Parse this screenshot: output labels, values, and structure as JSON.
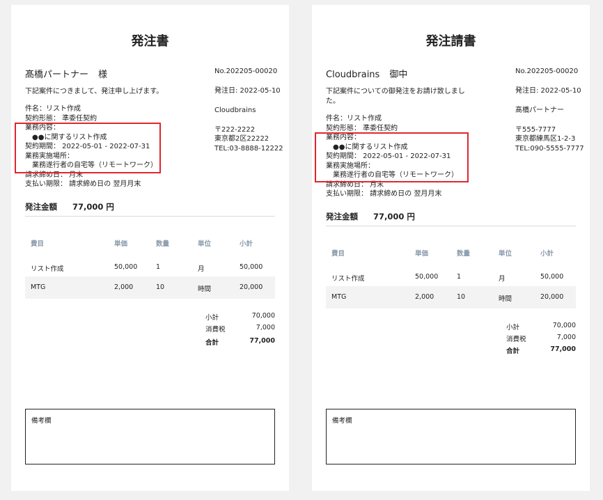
{
  "left_doc": {
    "title": "発注書",
    "addressee": "髙橋パートナー",
    "honorific": "様",
    "intro": "下記案件につきまして、発注申し上げます。",
    "lines": [
      "件名：リスト作成",
      "契約形態： 準委任契約",
      "業務内容：",
      "●●に関するリスト作成",
      "契約期間： 2022-05-01 - 2022-07-31",
      "業務実施場所：",
      "業務遂行者の自宅等（リモートワーク）",
      "請求締め日： 月末",
      "支払い期限： 請求締め日の 翌月月末"
    ],
    "doc_no": "No.202205-00020",
    "date": "発注日: 2022-05-10",
    "issuer": "Cloudbrains",
    "postal": "〒222-2222",
    "address": "東京都2区22222",
    "tel": "TEL:03-8888-12222",
    "amount_label": "発注金額",
    "amount_value": "77,000 円",
    "table_headers": [
      "費目",
      "単価",
      "数量",
      "単位",
      "小計"
    ],
    "rows": [
      [
        "リスト作成",
        "50,000",
        "1",
        "月",
        "50,000"
      ],
      [
        "MTG",
        "2,000",
        "10",
        "時間",
        "20,000"
      ]
    ],
    "subtotal_label": "小計",
    "subtotal": "70,000",
    "tax_label": "消費税",
    "tax": "7,000",
    "total_label": "合計",
    "total": "77,000",
    "notes_label": "備考欄"
  },
  "right_doc": {
    "title": "発注請書",
    "addressee": "Cloudbrains",
    "honorific": "御中",
    "intro_1": "下記案件についての御発注をお請け致しまし",
    "intro_2": "た。",
    "lines": [
      "件名：リスト作成",
      "契約形態： 準委任契約",
      "業務内容：",
      "●●に関するリスト作成",
      "契約期間： 2022-05-01 - 2022-07-31",
      "業務実施場所：",
      "業務遂行者の自宅等（リモートワーク）",
      "請求締め日： 月末",
      "支払い期限： 請求締め日の 翌月月末"
    ],
    "doc_no": "No.202205-00020",
    "date": "発注日: 2022-05-10",
    "issuer": "髙橋パートナー",
    "postal": "〒555-7777",
    "address": "東京都練馬区1-2-3",
    "tel": "TEL:090-5555-7777",
    "amount_label": "発注金額",
    "amount_value": "77,000 円",
    "table_headers": [
      "費目",
      "単価",
      "数量",
      "単位",
      "小計"
    ],
    "rows": [
      [
        "リスト作成",
        "50,000",
        "1",
        "月",
        "50,000"
      ],
      [
        "MTG",
        "2,000",
        "10",
        "時間",
        "20,000"
      ]
    ],
    "subtotal_label": "小計",
    "subtotal": "70,000",
    "tax_label": "消費税",
    "tax": "7,000",
    "total_label": "合計",
    "total": "77,000",
    "notes_label": "備考欄"
  },
  "colors": {
    "highlight": "#e0262d",
    "table_header": "#8a9aab",
    "row_alt": "#f3f3f3",
    "background": "#f1f1f1"
  }
}
